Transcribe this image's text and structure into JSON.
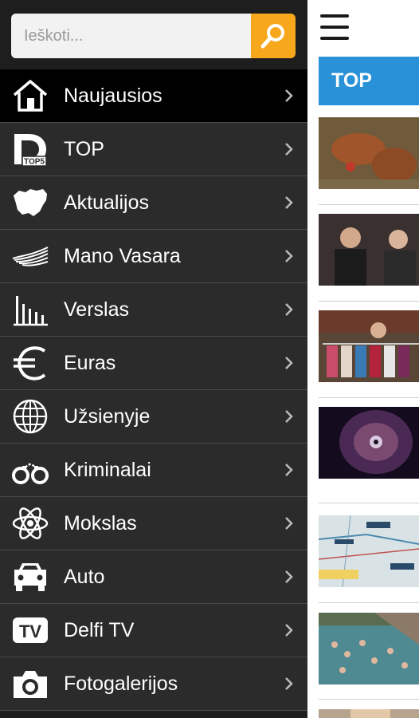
{
  "search": {
    "placeholder": "Ieškoti..."
  },
  "menu": {
    "items": [
      {
        "label": "Naujausios",
        "icon": "home-icon",
        "active": true
      },
      {
        "label": "TOP",
        "icon": "top5-icon"
      },
      {
        "label": "Aktualijos",
        "icon": "lithuania-map-icon"
      },
      {
        "label": "Mano Vasara",
        "icon": "wings-icon"
      },
      {
        "label": "Verslas",
        "icon": "bar-chart-icon"
      },
      {
        "label": "Euras",
        "icon": "euro-icon"
      },
      {
        "label": "Užsienyje",
        "icon": "globe-icon"
      },
      {
        "label": "Kriminalai",
        "icon": "handcuffs-icon"
      },
      {
        "label": "Mokslas",
        "icon": "atom-icon"
      },
      {
        "label": "Auto",
        "icon": "car-icon"
      },
      {
        "label": "Delfi TV",
        "icon": "tv-icon"
      },
      {
        "label": "Fotogalerijos",
        "icon": "camera-icon"
      }
    ]
  },
  "content": {
    "section_title": "TOP",
    "thumbnails": [
      "hens-photo",
      "politicians-photo",
      "woman-clothes-rack-photo",
      "space-nebula-photo",
      "aircraft-map-photo",
      "swimmers-beach-photo",
      "portrait-photo"
    ]
  },
  "colors": {
    "accent": "#f7a71b",
    "blue": "#2891d8",
    "drawer_bg": "#2b2b2b",
    "active_bg": "#000000"
  }
}
